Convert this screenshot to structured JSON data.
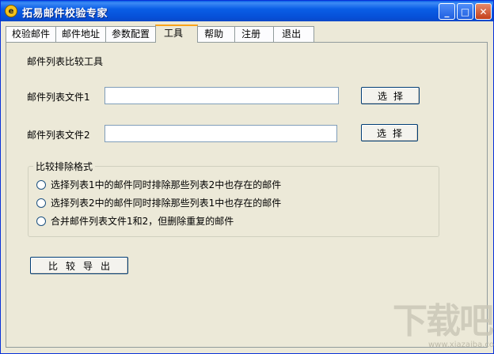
{
  "window": {
    "title": "拓易邮件校验专家",
    "app_icon_glyph": "e",
    "controls": {
      "minimize": "_",
      "maximize": "□",
      "close": "✕"
    }
  },
  "tabs": [
    {
      "label": "校验邮件",
      "active": false
    },
    {
      "label": "邮件地址",
      "active": false
    },
    {
      "label": "参数配置",
      "active": false
    },
    {
      "label": "工具",
      "active": true
    },
    {
      "label": "帮助",
      "active": false
    },
    {
      "label": "注册",
      "active": false
    },
    {
      "label": "退出",
      "active": false
    }
  ],
  "tool": {
    "section_title": "邮件列表比较工具",
    "file1": {
      "label": "邮件列表文件1",
      "value": "",
      "button": "选择"
    },
    "file2": {
      "label": "邮件列表文件2",
      "value": "",
      "button": "选择"
    },
    "group": {
      "legend": "比较排除格式",
      "options": [
        "选择列表1中的邮件同时排除那些列表2中也存在的邮件",
        "选择列表2中的邮件同时排除那些列表1中也存在的邮件",
        "合并邮件列表文件1和2，但删除重复的邮件"
      ]
    },
    "export_button": "比较导出"
  },
  "watermark": {
    "text": "下载吧",
    "url": "www.xiazaiba.com"
  },
  "colors": {
    "titlebar": "#0a5ee6",
    "window_bg": "#ece9d8",
    "active_tab_accent": "#f9a31a"
  }
}
